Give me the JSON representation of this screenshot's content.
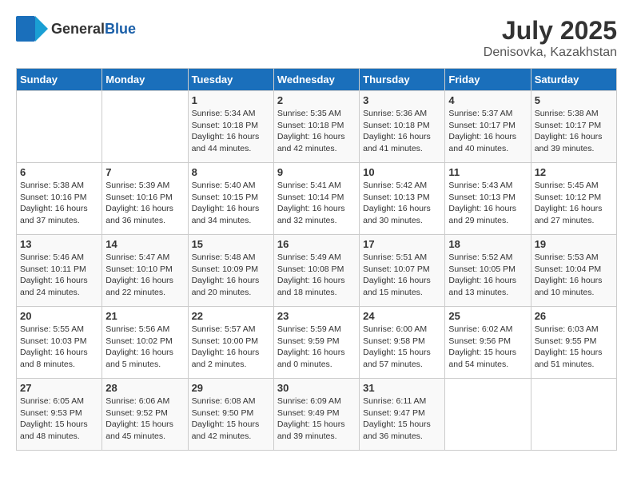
{
  "header": {
    "logo_general": "General",
    "logo_blue": "Blue",
    "month_year": "July 2025",
    "location": "Denisovka, Kazakhstan"
  },
  "weekdays": [
    "Sunday",
    "Monday",
    "Tuesday",
    "Wednesday",
    "Thursday",
    "Friday",
    "Saturday"
  ],
  "weeks": [
    [
      {
        "day": "",
        "info": ""
      },
      {
        "day": "",
        "info": ""
      },
      {
        "day": "1",
        "info": "Sunrise: 5:34 AM\nSunset: 10:18 PM\nDaylight: 16 hours\nand 44 minutes."
      },
      {
        "day": "2",
        "info": "Sunrise: 5:35 AM\nSunset: 10:18 PM\nDaylight: 16 hours\nand 42 minutes."
      },
      {
        "day": "3",
        "info": "Sunrise: 5:36 AM\nSunset: 10:18 PM\nDaylight: 16 hours\nand 41 minutes."
      },
      {
        "day": "4",
        "info": "Sunrise: 5:37 AM\nSunset: 10:17 PM\nDaylight: 16 hours\nand 40 minutes."
      },
      {
        "day": "5",
        "info": "Sunrise: 5:38 AM\nSunset: 10:17 PM\nDaylight: 16 hours\nand 39 minutes."
      }
    ],
    [
      {
        "day": "6",
        "info": "Sunrise: 5:38 AM\nSunset: 10:16 PM\nDaylight: 16 hours\nand 37 minutes."
      },
      {
        "day": "7",
        "info": "Sunrise: 5:39 AM\nSunset: 10:16 PM\nDaylight: 16 hours\nand 36 minutes."
      },
      {
        "day": "8",
        "info": "Sunrise: 5:40 AM\nSunset: 10:15 PM\nDaylight: 16 hours\nand 34 minutes."
      },
      {
        "day": "9",
        "info": "Sunrise: 5:41 AM\nSunset: 10:14 PM\nDaylight: 16 hours\nand 32 minutes."
      },
      {
        "day": "10",
        "info": "Sunrise: 5:42 AM\nSunset: 10:13 PM\nDaylight: 16 hours\nand 30 minutes."
      },
      {
        "day": "11",
        "info": "Sunrise: 5:43 AM\nSunset: 10:13 PM\nDaylight: 16 hours\nand 29 minutes."
      },
      {
        "day": "12",
        "info": "Sunrise: 5:45 AM\nSunset: 10:12 PM\nDaylight: 16 hours\nand 27 minutes."
      }
    ],
    [
      {
        "day": "13",
        "info": "Sunrise: 5:46 AM\nSunset: 10:11 PM\nDaylight: 16 hours\nand 24 minutes."
      },
      {
        "day": "14",
        "info": "Sunrise: 5:47 AM\nSunset: 10:10 PM\nDaylight: 16 hours\nand 22 minutes."
      },
      {
        "day": "15",
        "info": "Sunrise: 5:48 AM\nSunset: 10:09 PM\nDaylight: 16 hours\nand 20 minutes."
      },
      {
        "day": "16",
        "info": "Sunrise: 5:49 AM\nSunset: 10:08 PM\nDaylight: 16 hours\nand 18 minutes."
      },
      {
        "day": "17",
        "info": "Sunrise: 5:51 AM\nSunset: 10:07 PM\nDaylight: 16 hours\nand 15 minutes."
      },
      {
        "day": "18",
        "info": "Sunrise: 5:52 AM\nSunset: 10:05 PM\nDaylight: 16 hours\nand 13 minutes."
      },
      {
        "day": "19",
        "info": "Sunrise: 5:53 AM\nSunset: 10:04 PM\nDaylight: 16 hours\nand 10 minutes."
      }
    ],
    [
      {
        "day": "20",
        "info": "Sunrise: 5:55 AM\nSunset: 10:03 PM\nDaylight: 16 hours\nand 8 minutes."
      },
      {
        "day": "21",
        "info": "Sunrise: 5:56 AM\nSunset: 10:02 PM\nDaylight: 16 hours\nand 5 minutes."
      },
      {
        "day": "22",
        "info": "Sunrise: 5:57 AM\nSunset: 10:00 PM\nDaylight: 16 hours\nand 2 minutes."
      },
      {
        "day": "23",
        "info": "Sunrise: 5:59 AM\nSunset: 9:59 PM\nDaylight: 16 hours\nand 0 minutes."
      },
      {
        "day": "24",
        "info": "Sunrise: 6:00 AM\nSunset: 9:58 PM\nDaylight: 15 hours\nand 57 minutes."
      },
      {
        "day": "25",
        "info": "Sunrise: 6:02 AM\nSunset: 9:56 PM\nDaylight: 15 hours\nand 54 minutes."
      },
      {
        "day": "26",
        "info": "Sunrise: 6:03 AM\nSunset: 9:55 PM\nDaylight: 15 hours\nand 51 minutes."
      }
    ],
    [
      {
        "day": "27",
        "info": "Sunrise: 6:05 AM\nSunset: 9:53 PM\nDaylight: 15 hours\nand 48 minutes."
      },
      {
        "day": "28",
        "info": "Sunrise: 6:06 AM\nSunset: 9:52 PM\nDaylight: 15 hours\nand 45 minutes."
      },
      {
        "day": "29",
        "info": "Sunrise: 6:08 AM\nSunset: 9:50 PM\nDaylight: 15 hours\nand 42 minutes."
      },
      {
        "day": "30",
        "info": "Sunrise: 6:09 AM\nSunset: 9:49 PM\nDaylight: 15 hours\nand 39 minutes."
      },
      {
        "day": "31",
        "info": "Sunrise: 6:11 AM\nSunset: 9:47 PM\nDaylight: 15 hours\nand 36 minutes."
      },
      {
        "day": "",
        "info": ""
      },
      {
        "day": "",
        "info": ""
      }
    ]
  ]
}
